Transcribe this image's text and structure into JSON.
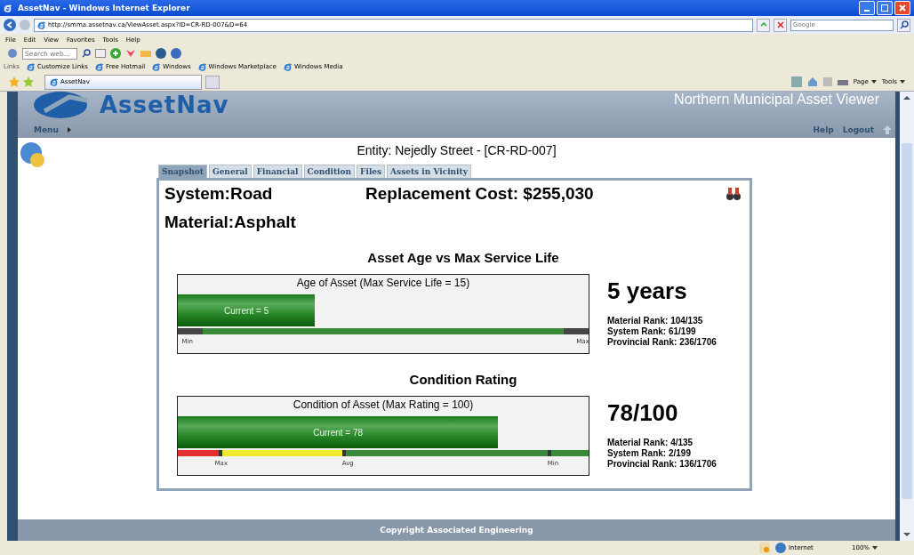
{
  "browser": {
    "title": "AssetNav - Windows Internet Explorer",
    "address": "http://smma.assetnav.ca/ViewAsset.aspx?ID=CR-RD-007&D=64",
    "search_placeholder": "Google",
    "menu": [
      "File",
      "Edit",
      "View",
      "Favorites",
      "Tools",
      "Help"
    ],
    "search_web_placeholder": "Search web...",
    "links_label": "Links",
    "links": [
      "Customize Links",
      "Free Hotmail",
      "Windows",
      "Windows Marketplace",
      "Windows Media"
    ],
    "tab": "AssetNav",
    "commands": [
      "Page",
      "Tools"
    ],
    "status": {
      "zone": "Internet",
      "zoom": "100%"
    }
  },
  "app": {
    "logo": "AssetNav",
    "header_title": "Northern Municipal Asset Viewer",
    "menu": "Menu",
    "help": "Help",
    "logout": "Logout",
    "entity": "Entity: Nejedly Street - [CR-RD-007]",
    "tabs": [
      {
        "label": "Snapshot",
        "selected": true
      },
      {
        "label": "General",
        "selected": false
      },
      {
        "label": "Financial",
        "selected": false
      },
      {
        "label": "Condition",
        "selected": false
      },
      {
        "label": "Files",
        "selected": false
      },
      {
        "label": "Assets in Vicinity",
        "selected": false
      }
    ],
    "system": "System:Road",
    "replacement": "Replacement Cost: $255,030",
    "material": "Material:Asphalt",
    "sections": [
      {
        "heading": "Asset Age vs Max Service Life",
        "gauge_title": "Age of Asset (Max Service Life = 15)",
        "current": "Current = 5",
        "level": 0.334,
        "kind": "ends",
        "segments": [
          {
            "color": "#444444"
          },
          {
            "color": "#3a8a3a"
          },
          {
            "color": "#444444"
          }
        ],
        "ticks": [
          "Min",
          "Max"
        ],
        "value": "5 years",
        "ranks": [
          "Material Rank: 104/135",
          "System Rank: 61/199",
          "Provincial Rank: 236/1706"
        ]
      },
      {
        "heading": "Condition Rating",
        "gauge_title": "Condition of Asset (Max Rating = 100)",
        "current": "Current = 78",
        "level": 0.78,
        "kind": "bands",
        "segments": [
          {
            "color": "#e03030"
          },
          {
            "color": "#f0e830"
          },
          {
            "color": "#3a8a3a"
          }
        ],
        "ticks": [
          "Max",
          "Avg",
          "Min"
        ],
        "value": "78/100",
        "ranks": [
          "Material Rank: 4/135",
          "System Rank: 2/199",
          "Provincial Rank: 136/1706"
        ]
      }
    ],
    "footer": "Copyright Associated Engineering"
  }
}
